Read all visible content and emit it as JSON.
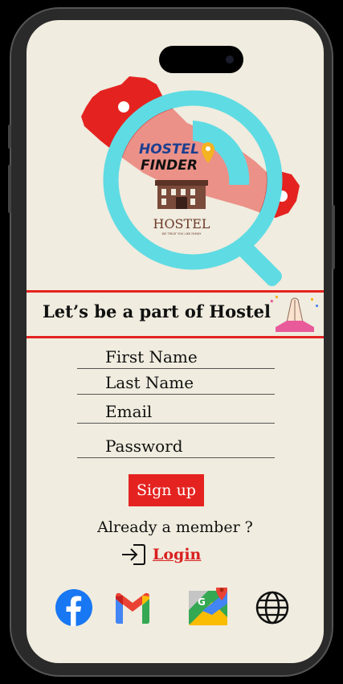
{
  "logo": {
    "brand_line1": "HOSTEL",
    "brand_line2": "FINDER",
    "hostel_text": "HOSTEL",
    "tagline": "WE TREAT YOU LIKE FAMILY",
    "icon": "magnifier-nepal-map-logo"
  },
  "banner": {
    "text": "Let’s be a part of Hostel",
    "icon": "namaste-hands-icon"
  },
  "form": {
    "first_name_label": "First Name",
    "last_name_label": "Last Name",
    "email_label": "Email",
    "password_label": "Password",
    "signup_label": "Sign up"
  },
  "login": {
    "prompt": "Already a member ?",
    "link_label": "Login",
    "icon": "login-arrow-icon"
  },
  "social": [
    "facebook-icon",
    "gmail-icon",
    "google-maps-icon",
    "globe-icon"
  ],
  "colors": {
    "accent": "#e42320",
    "background": "#f0ecdf",
    "magnifier": "#5fdbe3",
    "brand_blue": "#1c3f8f"
  }
}
